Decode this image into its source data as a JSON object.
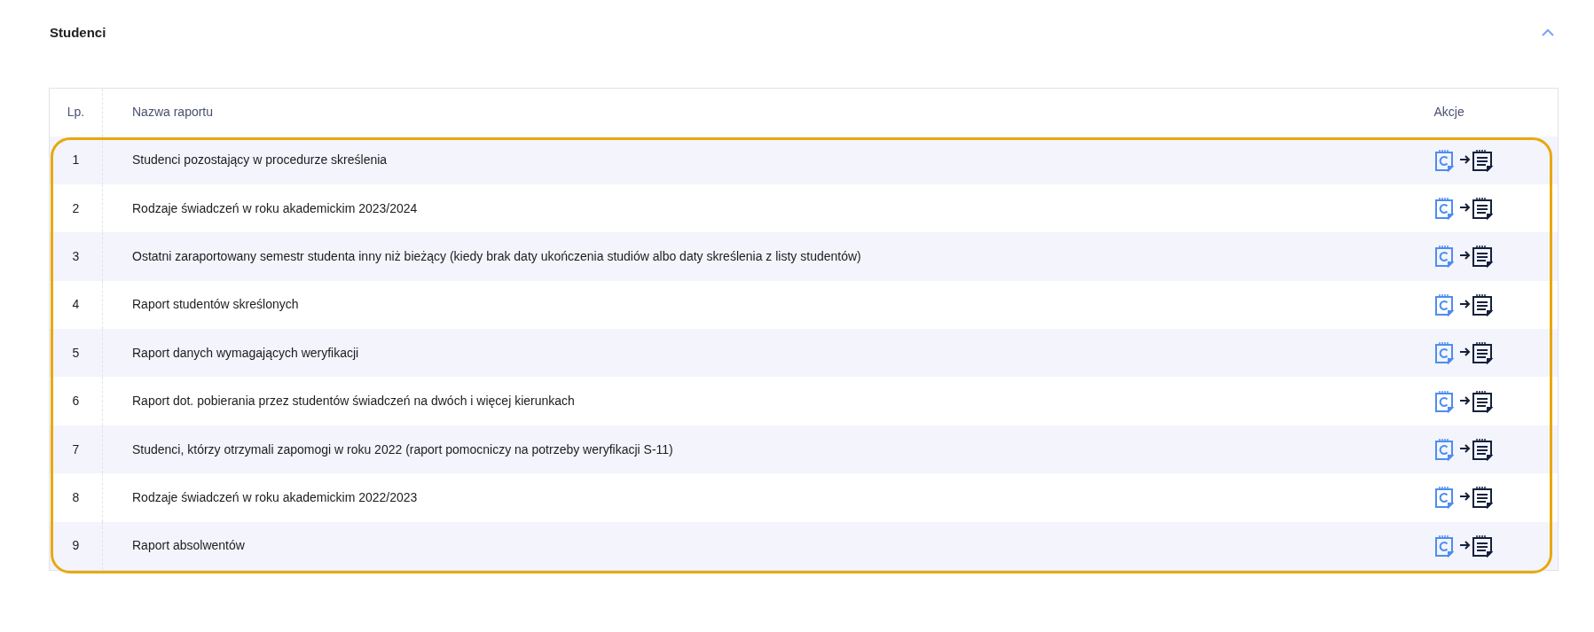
{
  "section": {
    "title": "Studenci",
    "expanded": true
  },
  "table": {
    "columns": [
      "Lp.",
      "Nazwa raportu",
      "Akcje"
    ],
    "highlighted": true,
    "rows": [
      {
        "lp": "1",
        "name": "Studenci pozostający w procedurze skreślenia"
      },
      {
        "lp": "2",
        "name": "Rodzaje świadczeń w roku akademickim 2023/2024"
      },
      {
        "lp": "3",
        "name": "Ostatni zaraportowany semestr studenta inny niż bieżący (kiedy brak daty ukończenia studiów albo daty skreślenia z listy studentów)"
      },
      {
        "lp": "4",
        "name": "Raport studentów skreślonych"
      },
      {
        "lp": "5",
        "name": "Raport danych wymagających weryfikacji"
      },
      {
        "lp": "6",
        "name": "Raport dot. pobierania przez studentów świadczeń na dwóch i więcej kierunkach"
      },
      {
        "lp": "7",
        "name": "Studenci, którzy otrzymali zapomogi w roku 2022 (raport pomocniczy na potrzeby weryfikacji S-11)"
      },
      {
        "lp": "8",
        "name": "Rodzaje świadczeń w roku akademickim 2022/2023"
      },
      {
        "lp": "9",
        "name": "Raport absolwentów"
      }
    ]
  }
}
